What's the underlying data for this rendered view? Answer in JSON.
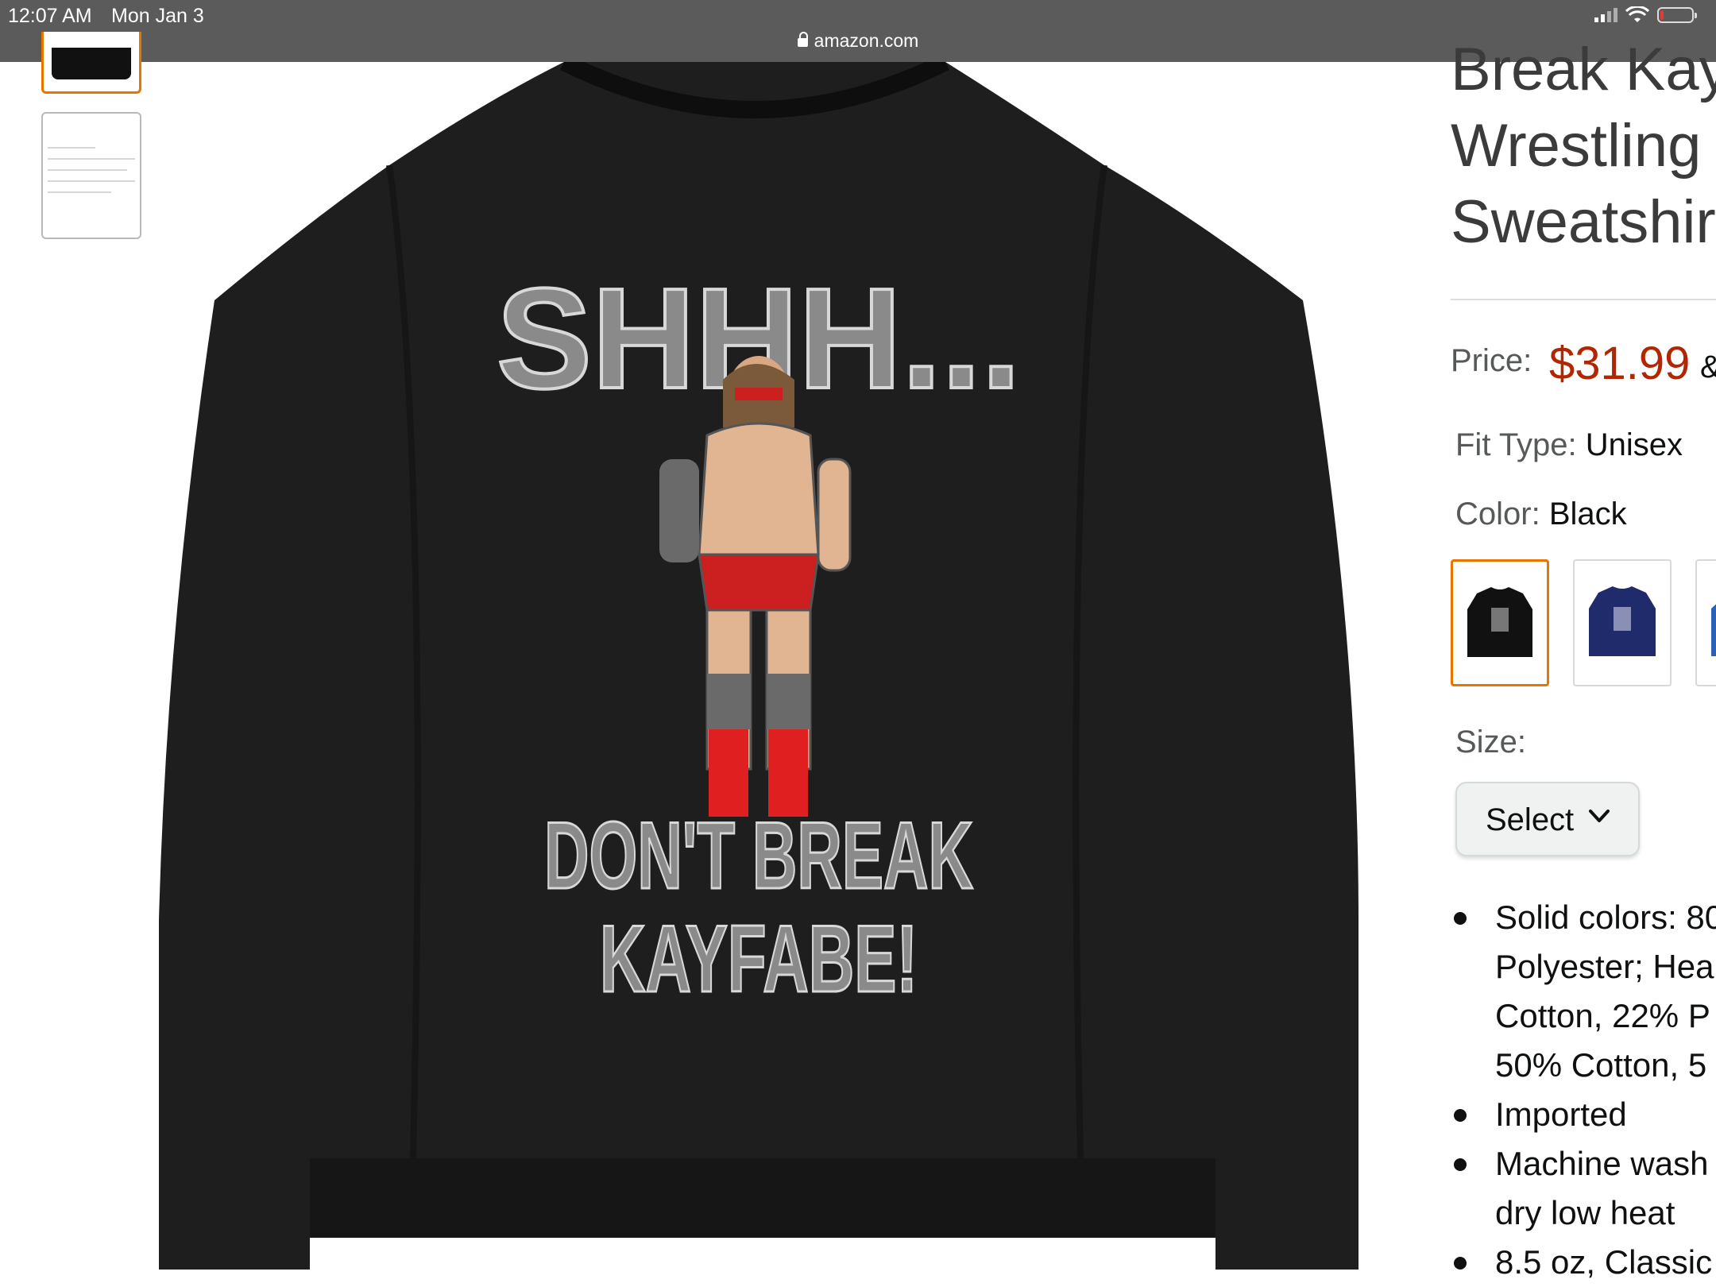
{
  "status_bar": {
    "time": "12:07 AM",
    "date": "Mon Jan 3",
    "url": "amazon.com"
  },
  "product": {
    "title": "Break Kay\nWrestling\nSweatshir",
    "shirt_text": {
      "line1": "SHHH...",
      "line2": "DON'T BREAK",
      "line3": "KAYFABE!"
    }
  },
  "price": {
    "label": "Price:",
    "value": "$31.99",
    "suffix": "&"
  },
  "fit_type": {
    "label": "Fit Type:",
    "value": "Unisex"
  },
  "color": {
    "label": "Color:",
    "value": "Black",
    "swatches": [
      "black",
      "navy",
      "royal-blue"
    ],
    "swatch_colors": [
      "#111111",
      "#1f2b6b",
      "#2c5fb8"
    ],
    "accent": "#e77600"
  },
  "size": {
    "label": "Size:",
    "select_label": "Select"
  },
  "bullets": [
    "Solid colors: 80\nPolyester; Hea\nCotton, 22% P\n50% Cotton, 5",
    "Imported",
    "Machine wash\ndry low heat",
    "8.5 oz, Classic"
  ]
}
